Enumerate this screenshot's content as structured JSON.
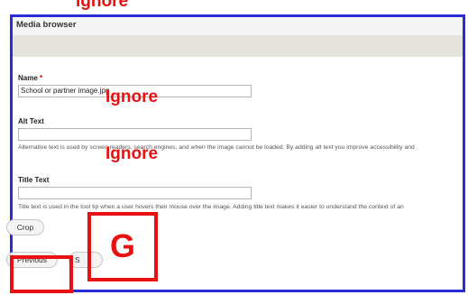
{
  "annotations": {
    "top": "Ignore",
    "name_note": "Ignore",
    "alt_note": "Ignore",
    "g_box": "G"
  },
  "dialog": {
    "title": "Media browser",
    "fields": {
      "name": {
        "label": "Name",
        "required_mark": "*",
        "value": "School or partner image.jpg"
      },
      "alt": {
        "label": "Alt Text",
        "value": "",
        "description": "Alternative text is used by screen readers, search engines, and when the image cannot be loaded. By adding alt text you improve accessibility and"
      },
      "title_text": {
        "label": "Title Text",
        "value": "",
        "description": "Title text is used in the tool tip when a user hovers their mouse over the image. Adding title text makes it easier to understand the context of an"
      }
    },
    "buttons": {
      "crop": "Crop",
      "previous": "Previous",
      "save_partial": "S"
    }
  },
  "colors": {
    "dialog_border": "#2b2bd8",
    "annotation": "#e81010",
    "required": "#cc0000"
  }
}
